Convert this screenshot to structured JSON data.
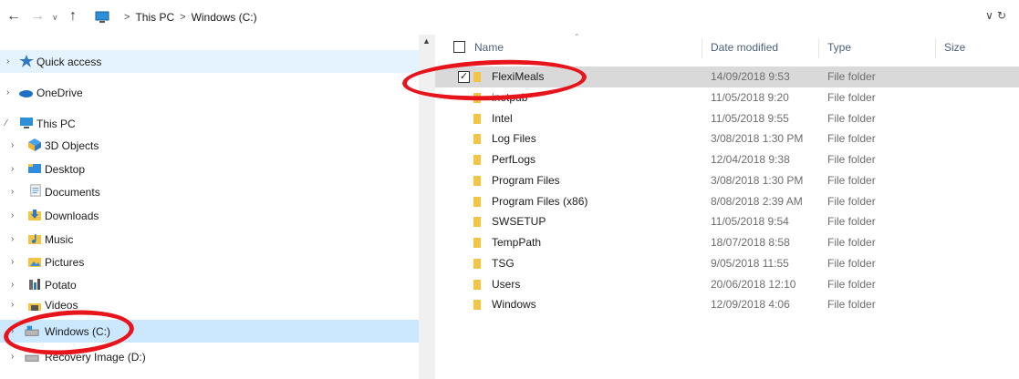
{
  "address_bar": {
    "crumbs": [
      "This PC",
      "Windows (C:)"
    ],
    "separator": ">"
  },
  "icons": {
    "back": "arrow-left-icon",
    "forward": "arrow-right-icon",
    "recent": "chevron-down-icon",
    "up": "arrow-up-icon",
    "dropdown": "chevron-down-icon",
    "refresh": "refresh-icon",
    "folder": "folder-icon"
  },
  "nav_tree": {
    "items": [
      {
        "label": "Quick access"
      },
      {
        "label": "OneDrive"
      },
      {
        "label": "This PC"
      },
      {
        "label": "3D Objects"
      },
      {
        "label": "Desktop"
      },
      {
        "label": "Documents"
      },
      {
        "label": "Downloads"
      },
      {
        "label": "Music"
      },
      {
        "label": "Pictures"
      },
      {
        "label": "Potato"
      },
      {
        "label": "Videos"
      },
      {
        "label": "Windows (C:)"
      },
      {
        "label": "Recovery Image (D:)"
      }
    ]
  },
  "file_list": {
    "columns": {
      "name": "Name",
      "date": "Date modified",
      "type": "Type",
      "size": "Size"
    },
    "rows": [
      {
        "name": "FlexiMeals",
        "date": "14/09/2018 9:53",
        "type": "File folder",
        "checked": true
      },
      {
        "name": "inetpub",
        "date": "11/05/2018 9:20",
        "type": "File folder"
      },
      {
        "name": "Intel",
        "date": "11/05/2018 9:55",
        "type": "File folder"
      },
      {
        "name": "Log Files",
        "date": "3/08/2018 1:30 PM",
        "type": "File folder"
      },
      {
        "name": "PerfLogs",
        "date": "12/04/2018 9:38",
        "type": "File folder"
      },
      {
        "name": "Program Files",
        "date": "3/08/2018 1:30 PM",
        "type": "File folder"
      },
      {
        "name": "Program Files (x86)",
        "date": "8/08/2018 2:39 AM",
        "type": "File folder"
      },
      {
        "name": "SWSETUP",
        "date": "11/05/2018 9:54",
        "type": "File folder"
      },
      {
        "name": "TempPath",
        "date": "18/07/2018 8:58",
        "type": "File folder"
      },
      {
        "name": "TSG",
        "date": "9/05/2018 11:55",
        "type": "File folder"
      },
      {
        "name": "Users",
        "date": "20/06/2018 12:10",
        "type": "File folder"
      },
      {
        "name": "Windows",
        "date": "12/09/2018 4:06",
        "type": "File folder"
      }
    ]
  },
  "colors": {
    "annotation": "#e8141c",
    "selected_row": "#d9d9d9",
    "nav_selected": "#cce8ff",
    "folder": "#f4c542"
  }
}
